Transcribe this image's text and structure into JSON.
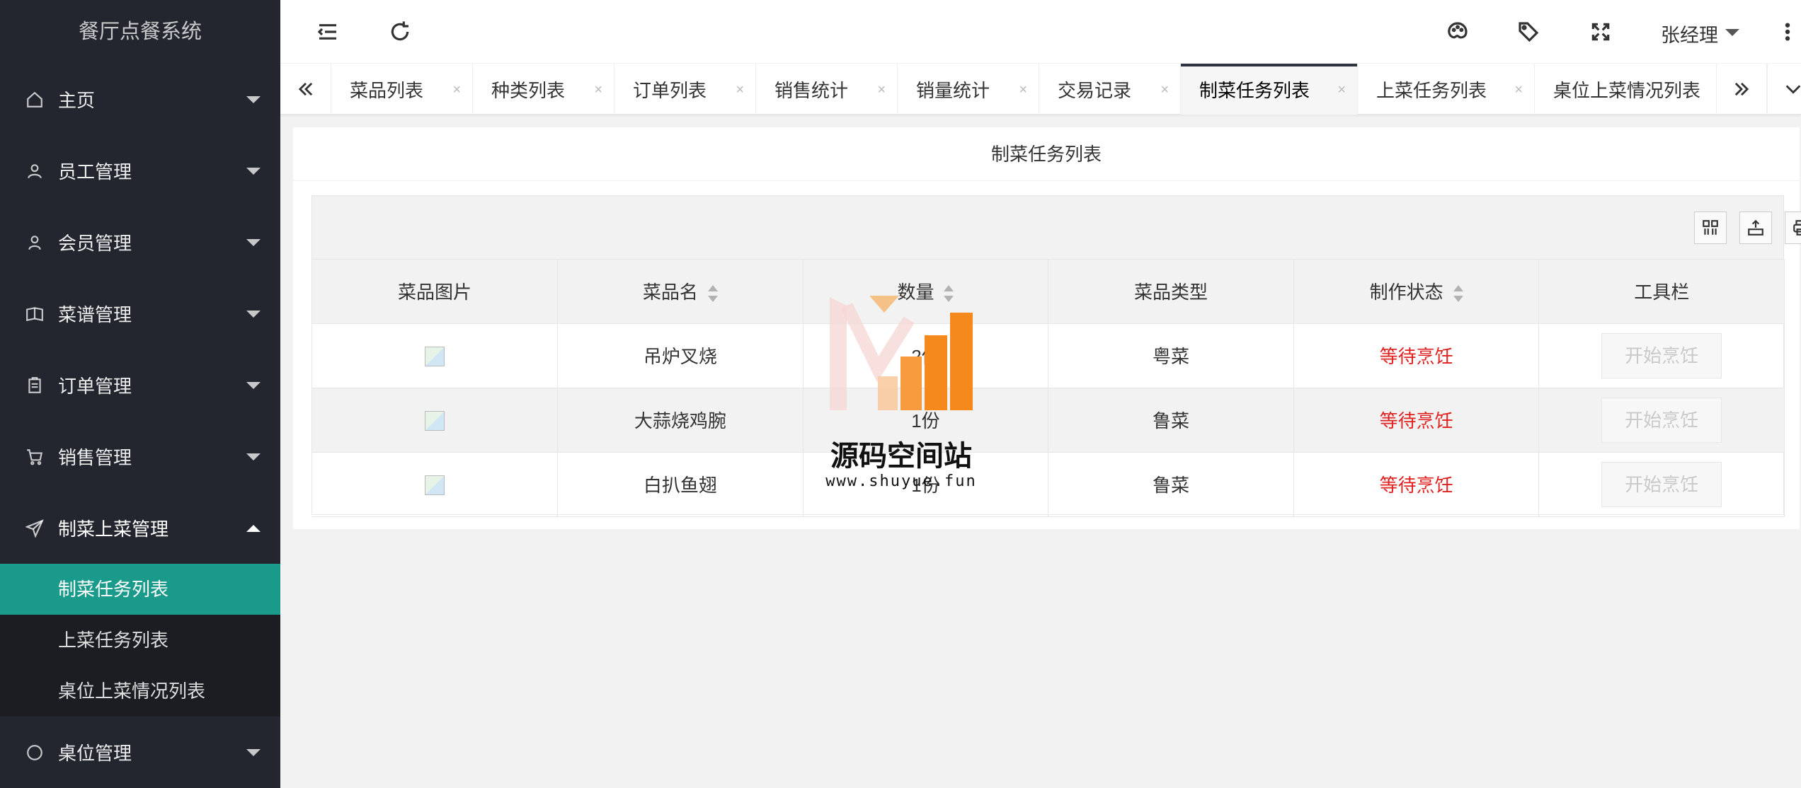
{
  "app": {
    "title": "餐厅点餐系统"
  },
  "sidebar": {
    "items": [
      {
        "label": "主页",
        "icon": "home-icon"
      },
      {
        "label": "员工管理",
        "icon": "staff-icon"
      },
      {
        "label": "会员管理",
        "icon": "user-icon"
      },
      {
        "label": "菜谱管理",
        "icon": "book-icon"
      },
      {
        "label": "订单管理",
        "icon": "clipboard-icon"
      },
      {
        "label": "销售管理",
        "icon": "cart-icon"
      },
      {
        "label": "制菜上菜管理",
        "icon": "send-icon"
      },
      {
        "label": "桌位管理",
        "icon": "circle-icon"
      }
    ],
    "subitems": [
      {
        "label": "制菜任务列表"
      },
      {
        "label": "上菜任务列表"
      },
      {
        "label": "桌位上菜情况列表"
      }
    ]
  },
  "header": {
    "user_name": "张经理"
  },
  "tabs": [
    {
      "label": "菜品列表"
    },
    {
      "label": "种类列表"
    },
    {
      "label": "订单列表"
    },
    {
      "label": "销售统计"
    },
    {
      "label": "销量统计"
    },
    {
      "label": "交易记录"
    },
    {
      "label": "制菜任务列表"
    },
    {
      "label": "上菜任务列表"
    },
    {
      "label": "桌位上菜情况列表"
    }
  ],
  "tab_close": "×",
  "main": {
    "title": "制菜任务列表",
    "columns": [
      "菜品图片",
      "菜品名",
      "数量",
      "菜品类型",
      "制作状态",
      "工具栏"
    ],
    "rows": [
      {
        "name": "吊炉叉烧",
        "qty": "2份",
        "type": "粤菜",
        "status": "等待烹饪",
        "action": "开始烹饪"
      },
      {
        "name": "大蒜烧鸡腕",
        "qty": "1份",
        "type": "鲁菜",
        "status": "等待烹饪",
        "action": "开始烹饪"
      },
      {
        "name": "白扒鱼翅",
        "qty": "1份",
        "type": "鲁菜",
        "status": "等待烹饪",
        "action": "开始烹饪"
      }
    ]
  },
  "watermark": {
    "title": "源码空间站",
    "url": "www.shuyue.fun"
  },
  "colors": {
    "sidebar_bg": "#23262e",
    "active_teal": "#1a9a8a",
    "status_red": "#e0211f"
  }
}
